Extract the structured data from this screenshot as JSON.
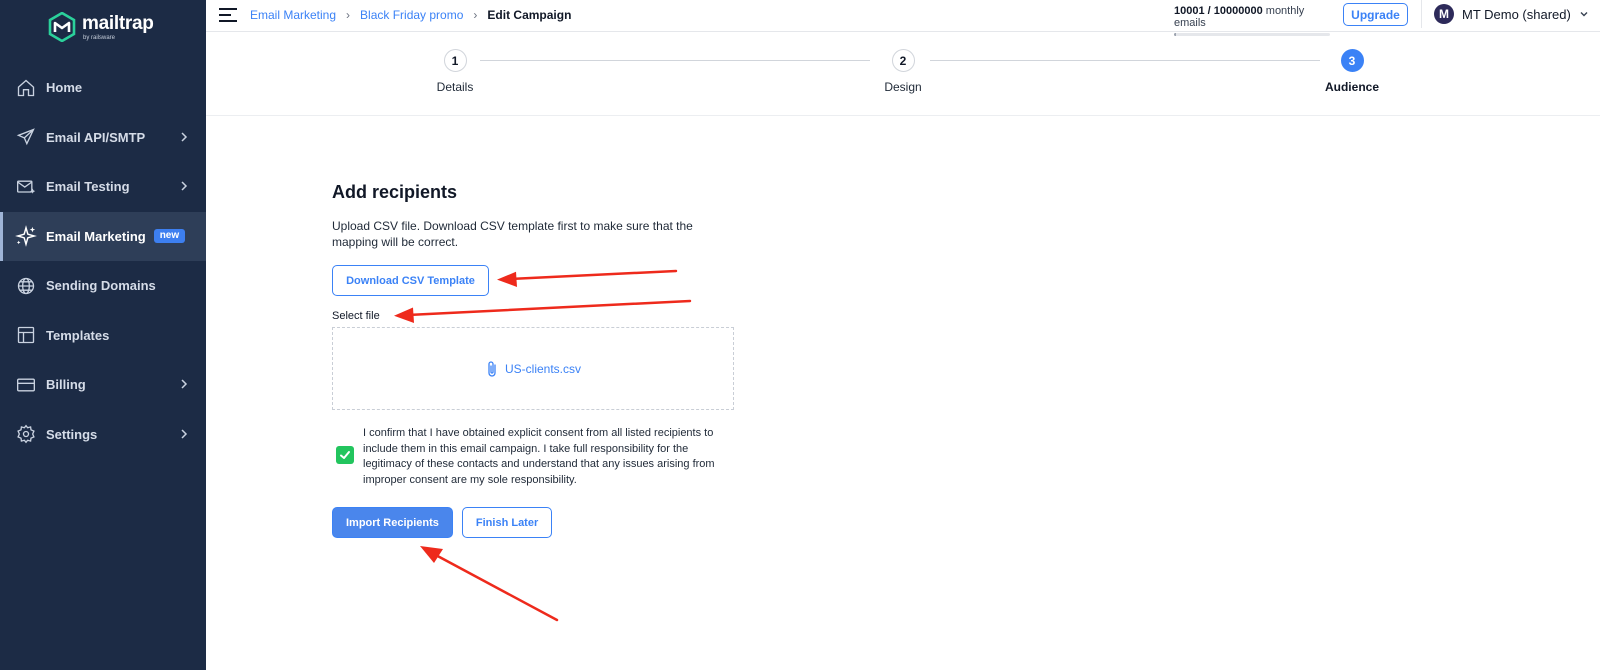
{
  "sidebar": {
    "logo": {
      "name": "mailtrap",
      "sub": "by railsware"
    },
    "items": [
      {
        "label": "Home",
        "icon": "home-icon",
        "chevron": false,
        "active": false
      },
      {
        "label": "Email API/SMTP",
        "icon": "send-icon",
        "chevron": true,
        "active": false
      },
      {
        "label": "Email Testing",
        "icon": "envelope-sparkle-icon",
        "chevron": true,
        "active": false
      },
      {
        "label": "Email Marketing",
        "icon": "sparkles-icon",
        "chevron": false,
        "active": true,
        "badge": "new"
      },
      {
        "label": "Sending Domains",
        "icon": "globe-icon",
        "chevron": false,
        "active": false
      },
      {
        "label": "Templates",
        "icon": "layout-icon",
        "chevron": false,
        "active": false
      },
      {
        "label": "Billing",
        "icon": "credit-card-icon",
        "chevron": true,
        "active": false
      },
      {
        "label": "Settings",
        "icon": "gear-icon",
        "chevron": true,
        "active": false
      }
    ]
  },
  "topbar": {
    "breadcrumb": [
      "Email Marketing",
      "Black Friday promo",
      "Edit Campaign"
    ],
    "quota": {
      "used": "10001",
      "limit": "10000000",
      "suffix": "monthly emails",
      "fraction": 0.001
    },
    "upgrade_label": "Upgrade",
    "account": {
      "initial": "M",
      "name": "MT Demo (shared)"
    }
  },
  "stepper": {
    "steps": [
      {
        "number": "1",
        "label": "Details",
        "active": false
      },
      {
        "number": "2",
        "label": "Design",
        "active": false
      },
      {
        "number": "3",
        "label": "Audience",
        "active": true
      }
    ]
  },
  "main": {
    "heading": "Add recipients",
    "description": "Upload CSV file. Download CSV template first to make sure that the mapping will be correct.",
    "download_label": "Download CSV Template",
    "select_file_label": "Select file",
    "file_name": "US-clients.csv",
    "consent_checked": true,
    "consent_text": "I confirm that I have obtained explicit consent from all listed recipients to include them in this email campaign. I take full responsibility for the legitimacy of these contacts and understand that any issues arising from improper consent are my sole responsibility.",
    "import_label": "Import Recipients",
    "finish_label": "Finish Later"
  },
  "colors": {
    "sidebar_bg": "#1c2b45",
    "accent": "#3b82f6",
    "check_green": "#22c55e",
    "annotation_red": "#ee2a1c"
  }
}
